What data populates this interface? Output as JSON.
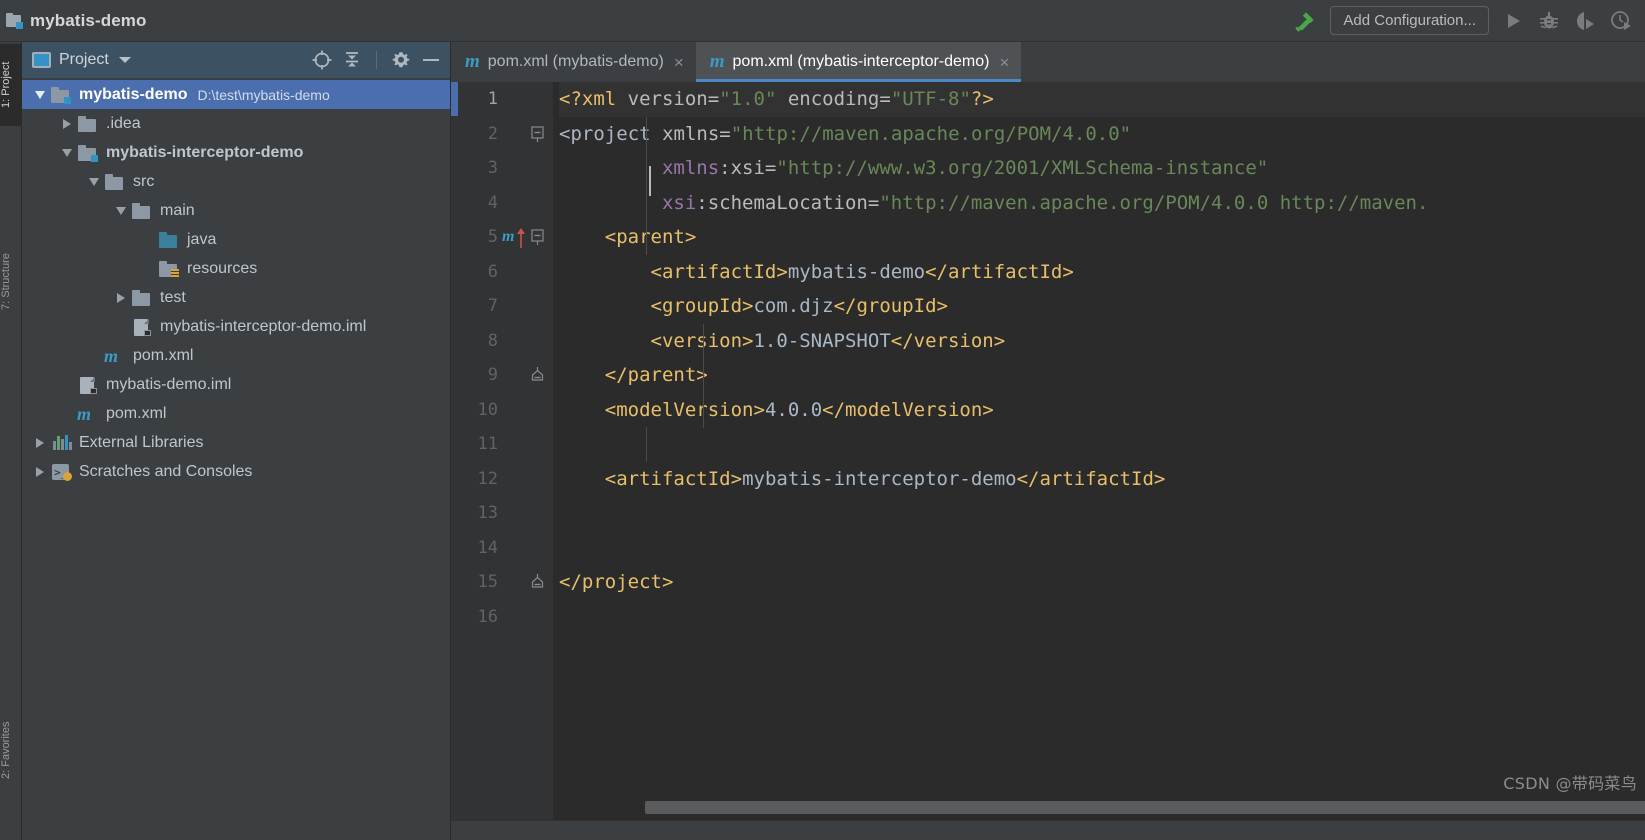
{
  "window": {
    "project_icon": "module-folder-icon",
    "title": "mybatis-demo"
  },
  "toolbar": {
    "build_icon": "hammer-icon",
    "add_configuration_label": "Add Configuration...",
    "run_icon": "run-icon",
    "debug_icon": "debug-icon",
    "coverage_icon": "run-with-coverage-icon",
    "profiler_icon": "profiler-icon"
  },
  "left_strip": {
    "project_label": "1: Project",
    "structure_label": "7: Structure",
    "favorites_label": "2: Favorites"
  },
  "project_panel": {
    "header": {
      "mode_icon": "project-view-icon",
      "title": "Project",
      "dropdown_icon": "chevron-down-icon",
      "locate_icon": "scroll-from-source-icon",
      "collapse_icon": "collapse-all-icon",
      "settings_icon": "gear-icon",
      "hide_icon": "minimize-icon"
    },
    "tree": [
      {
        "label": "mybatis-demo",
        "path": "D:\\test\\mybatis-demo",
        "icon": "module-folder-icon",
        "indent": 0,
        "arrow": "down",
        "bold": true,
        "selected": true
      },
      {
        "label": ".idea",
        "path": "",
        "icon": "folder-icon",
        "indent": 1,
        "arrow": "right",
        "bold": false,
        "selected": false
      },
      {
        "label": "mybatis-interceptor-demo",
        "path": "",
        "icon": "module-folder-icon",
        "indent": 1,
        "arrow": "down",
        "bold": true,
        "selected": false
      },
      {
        "label": "src",
        "path": "",
        "icon": "folder-icon",
        "indent": 2,
        "arrow": "down",
        "bold": false,
        "selected": false
      },
      {
        "label": "main",
        "path": "",
        "icon": "folder-icon",
        "indent": 3,
        "arrow": "down",
        "bold": false,
        "selected": false
      },
      {
        "label": "java",
        "path": "",
        "icon": "source-root-folder-icon",
        "indent": 4,
        "arrow": "none",
        "bold": false,
        "selected": false
      },
      {
        "label": "resources",
        "path": "",
        "icon": "resources-root-folder-icon",
        "indent": 4,
        "arrow": "none",
        "bold": false,
        "selected": false
      },
      {
        "label": "test",
        "path": "",
        "icon": "folder-icon",
        "indent": 3,
        "arrow": "right",
        "bold": false,
        "selected": false
      },
      {
        "label": "mybatis-interceptor-demo.iml",
        "path": "",
        "icon": "iml-file-icon",
        "indent": 3,
        "arrow": "none",
        "bold": false,
        "selected": false
      },
      {
        "label": "pom.xml",
        "path": "",
        "icon": "maven-file-icon",
        "indent": 2,
        "arrow": "none",
        "bold": false,
        "selected": false
      },
      {
        "label": "mybatis-demo.iml",
        "path": "",
        "icon": "iml-file-icon",
        "indent": 1,
        "arrow": "none",
        "bold": false,
        "selected": false
      },
      {
        "label": "pom.xml",
        "path": "",
        "icon": "maven-file-icon",
        "indent": 1,
        "arrow": "none",
        "bold": false,
        "selected": false
      },
      {
        "label": "External Libraries",
        "path": "",
        "icon": "external-libraries-icon",
        "indent": 0,
        "arrow": "right",
        "bold": false,
        "selected": false
      },
      {
        "label": "Scratches and Consoles",
        "path": "",
        "icon": "scratches-icon",
        "indent": 0,
        "arrow": "right",
        "bold": false,
        "selected": false
      }
    ]
  },
  "editor": {
    "tabs": [
      {
        "label": "pom.xml (mybatis-demo)",
        "icon": "maven-file-icon",
        "close_icon": "close-icon",
        "active": false
      },
      {
        "label": "pom.xml (mybatis-interceptor-demo)",
        "icon": "maven-file-icon",
        "close_icon": "close-icon",
        "active": true
      }
    ],
    "filename": "pom.xml",
    "gutter_marker_line": 5,
    "gutter_marker_icon": "maven-parent-navigate-icon",
    "current_line": 1,
    "lines": [
      {
        "n": 1,
        "fold": "none",
        "marker": false
      },
      {
        "n": 2,
        "fold": "open",
        "marker": false
      },
      {
        "n": 3,
        "fold": "none",
        "marker": false
      },
      {
        "n": 4,
        "fold": "none",
        "marker": false
      },
      {
        "n": 5,
        "fold": "open",
        "marker": true
      },
      {
        "n": 6,
        "fold": "none",
        "marker": false
      },
      {
        "n": 7,
        "fold": "none",
        "marker": false
      },
      {
        "n": 8,
        "fold": "none",
        "marker": false
      },
      {
        "n": 9,
        "fold": "close",
        "marker": false
      },
      {
        "n": 10,
        "fold": "none",
        "marker": false
      },
      {
        "n": 11,
        "fold": "none",
        "marker": false
      },
      {
        "n": 12,
        "fold": "none",
        "marker": false
      },
      {
        "n": 13,
        "fold": "none",
        "marker": false
      },
      {
        "n": 14,
        "fold": "none",
        "marker": false
      },
      {
        "n": 15,
        "fold": "close",
        "marker": false
      },
      {
        "n": 16,
        "fold": "none",
        "marker": false
      }
    ],
    "code": [
      "<?xml version=\"1.0\" encoding=\"UTF-8\"?>",
      "<project xmlns=\"http://maven.apache.org/POM/4.0.0\"",
      "         xmlns:xsi=\"http://www.w3.org/2001/XMLSchema-instance\"",
      "         xsi:schemaLocation=\"http://maven.apache.org/POM/4.0.0 http://maven.",
      "    <parent>",
      "        <artifactId>mybatis-demo</artifactId>",
      "        <groupId>com.djz</groupId>",
      "        <version>1.0-SNAPSHOT</version>",
      "    </parent>",
      "    <modelVersion>4.0.0</modelVersion>",
      "",
      "    <artifactId>mybatis-interceptor-demo</artifactId>",
      "",
      "",
      "</project>",
      ""
    ]
  },
  "watermark": {
    "text": "CSDN @带码菜鸟"
  },
  "colors": {
    "accent_blue": "#4b6eaf",
    "tab_underline": "#4a88c7",
    "editor_bg": "#2b2b2b",
    "panel_bg": "#3c3f41",
    "gutter_bg": "#313335",
    "xml_tag": "#e8bf6a",
    "xml_value": "#6a8759",
    "xml_ns": "#9876aa",
    "text": "#a9b7c6",
    "maven_icon": "#3b9bc4",
    "build_green": "#49a64a"
  }
}
